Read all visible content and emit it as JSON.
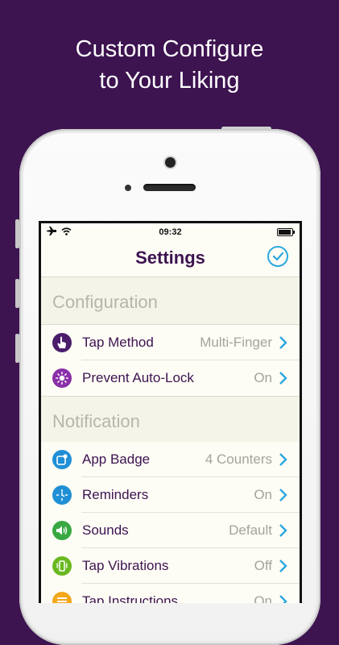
{
  "headline": {
    "line1": "Custom Configure",
    "line2": "to Your Liking"
  },
  "status_bar": {
    "time": "09:32"
  },
  "nav": {
    "title": "Settings"
  },
  "sections": [
    {
      "header": "Configuration",
      "rows": [
        {
          "label": "Tap Method",
          "value": "Multi-Finger",
          "icon": "hand-tap-icon",
          "icon_color": "#4a1d6b"
        },
        {
          "label": "Prevent Auto-Lock",
          "value": "On",
          "icon": "sun-icon",
          "icon_color": "#8a2fa8"
        }
      ]
    },
    {
      "header": "Notification",
      "rows": [
        {
          "label": "App Badge",
          "value": "4 Counters",
          "icon": "badge-icon",
          "icon_color": "#1f8fd6"
        },
        {
          "label": "Reminders",
          "value": "On",
          "icon": "clock-icon",
          "icon_color": "#1f8fd6"
        },
        {
          "label": "Sounds",
          "value": "Default",
          "icon": "speaker-icon",
          "icon_color": "#38a842"
        },
        {
          "label": "Tap Vibrations",
          "value": "Off",
          "icon": "vibrate-icon",
          "icon_color": "#69b821"
        },
        {
          "label": "Tap Instructions",
          "value": "On",
          "icon": "list-icon",
          "icon_color": "#f2a81c"
        }
      ]
    }
  ],
  "colors": {
    "background": "#3d1350",
    "accent": "#2aa8e0",
    "title": "#3d1350"
  }
}
